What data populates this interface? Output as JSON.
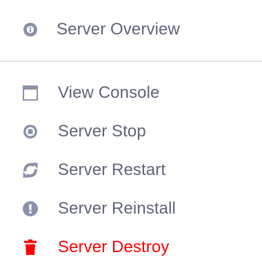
{
  "colors": {
    "icon": "#8b91a8",
    "text": "#5e6478",
    "danger": "#ff0000",
    "divider": "#e4e6ea"
  },
  "menu": {
    "items": [
      {
        "label": "Server Overview",
        "icon": "info-circle-icon"
      },
      {
        "label": "View Console",
        "icon": "window-icon"
      },
      {
        "label": "Server Stop",
        "icon": "stop-circle-icon"
      },
      {
        "label": "Server Restart",
        "icon": "restart-icon"
      },
      {
        "label": "Server Reinstall",
        "icon": "exclamation-circle-icon"
      },
      {
        "label": "Server Destroy",
        "icon": "trash-icon"
      }
    ]
  }
}
